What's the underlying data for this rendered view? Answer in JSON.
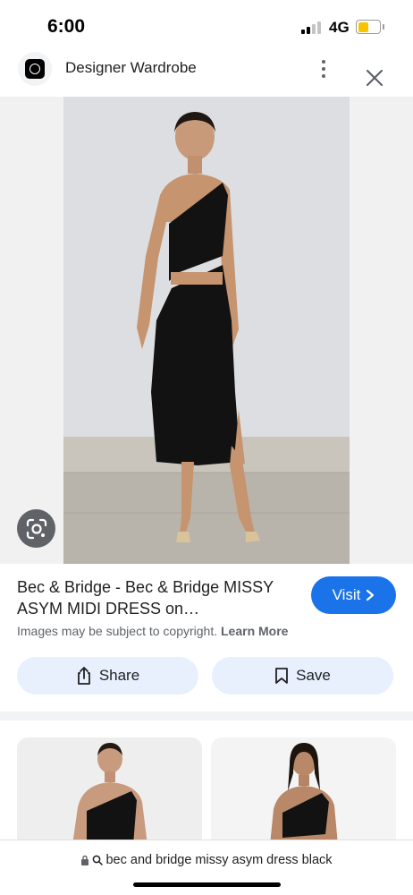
{
  "status_bar": {
    "time": "6:00",
    "network": "4G",
    "battery_level": 0.5,
    "battery_color": "#f6c400"
  },
  "header": {
    "site_name": "Designer Wardrobe",
    "logo_icon": "designer-wardrobe-logo",
    "menu_icon": "more-vert-icon",
    "close_icon": "close-icon"
  },
  "viewer": {
    "image_alt": "Model wearing black one-shoulder asymmetric midi dress with cutout",
    "lens_icon": "google-lens-icon"
  },
  "result": {
    "title": "Bec & Bridge - Bec & Bridge MISSY ASYM MIDI DRESS on…",
    "visit_label": "Visit",
    "copyright_text": "Images may be subject to copyright.",
    "learn_more": "Learn More"
  },
  "actions": {
    "share_label": "Share",
    "save_label": "Save"
  },
  "url_bar": {
    "query": "bec and bridge missy asym dress black"
  },
  "colors": {
    "accent": "#1a73e8",
    "chip_bg": "#e8f0fe"
  }
}
